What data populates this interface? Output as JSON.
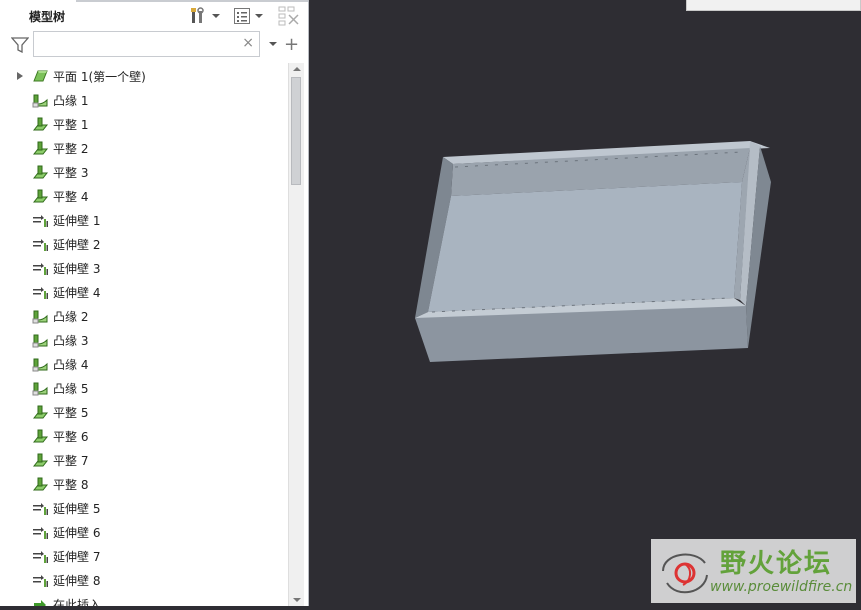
{
  "panel": {
    "title": "模型树",
    "search": {
      "value": "",
      "placeholder": ""
    },
    "clear_glyph": "×",
    "add_glyph": "+",
    "icons": {
      "settings": "tools-icon",
      "show": "list-icon",
      "columns": "tree-columns-icon",
      "filter": "filter-icon"
    }
  },
  "tree": {
    "items": [
      {
        "label": "平面 1(第一个壁)",
        "icon": "planar-wall-icon",
        "expandable": true
      },
      {
        "label": "凸缘 1",
        "icon": "flange-icon"
      },
      {
        "label": "平整 1",
        "icon": "flat-wall-icon"
      },
      {
        "label": "平整 2",
        "icon": "flat-wall-icon"
      },
      {
        "label": "平整 3",
        "icon": "flat-wall-icon"
      },
      {
        "label": "平整 4",
        "icon": "flat-wall-icon"
      },
      {
        "label": "延伸壁 1",
        "icon": "extend-wall-icon"
      },
      {
        "label": "延伸壁 2",
        "icon": "extend-wall-icon"
      },
      {
        "label": "延伸壁 3",
        "icon": "extend-wall-icon"
      },
      {
        "label": "延伸壁 4",
        "icon": "extend-wall-icon"
      },
      {
        "label": "凸缘 2",
        "icon": "flange-icon"
      },
      {
        "label": "凸缘 3",
        "icon": "flange-icon"
      },
      {
        "label": "凸缘 4",
        "icon": "flange-icon"
      },
      {
        "label": "凸缘 5",
        "icon": "flange-icon"
      },
      {
        "label": "平整 5",
        "icon": "flat-wall-icon"
      },
      {
        "label": "平整 6",
        "icon": "flat-wall-icon"
      },
      {
        "label": "平整 7",
        "icon": "flat-wall-icon"
      },
      {
        "label": "平整 8",
        "icon": "flat-wall-icon"
      },
      {
        "label": "延伸壁 5",
        "icon": "extend-wall-icon"
      },
      {
        "label": "延伸壁 6",
        "icon": "extend-wall-icon"
      },
      {
        "label": "延伸壁 7",
        "icon": "extend-wall-icon"
      },
      {
        "label": "延伸壁 8",
        "icon": "extend-wall-icon"
      },
      {
        "label": "在此插入",
        "icon": "insert-here-icon"
      }
    ]
  },
  "watermark": {
    "name": "野火论坛",
    "url": "www.proewildfire.cn"
  },
  "colors": {
    "viewport_bg": "#2e2d33",
    "model_face": "#a9b4c0",
    "model_side": "#8c95a0",
    "icon_green": "#5fa33a",
    "watermark_green": "#63a23b"
  }
}
